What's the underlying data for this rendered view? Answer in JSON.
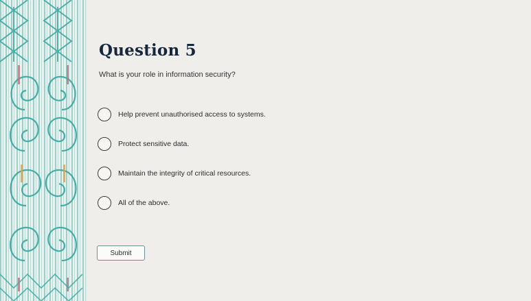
{
  "quiz": {
    "title": "Question 5",
    "question": "What is your role in information security?",
    "options": [
      {
        "label": "Help prevent unauthorised access to systems."
      },
      {
        "label": "Protect sensitive data."
      },
      {
        "label": "Maintain the integrity of critical resources."
      },
      {
        "label": "All of the above."
      }
    ],
    "submit_label": "Submit"
  },
  "decor": {
    "pattern_colors": {
      "teal": "#3ea9a2",
      "teal_light": "#8fcfc8",
      "rose": "#b77a86",
      "gold": "#c8a86a",
      "background": "#eef0ed"
    }
  }
}
